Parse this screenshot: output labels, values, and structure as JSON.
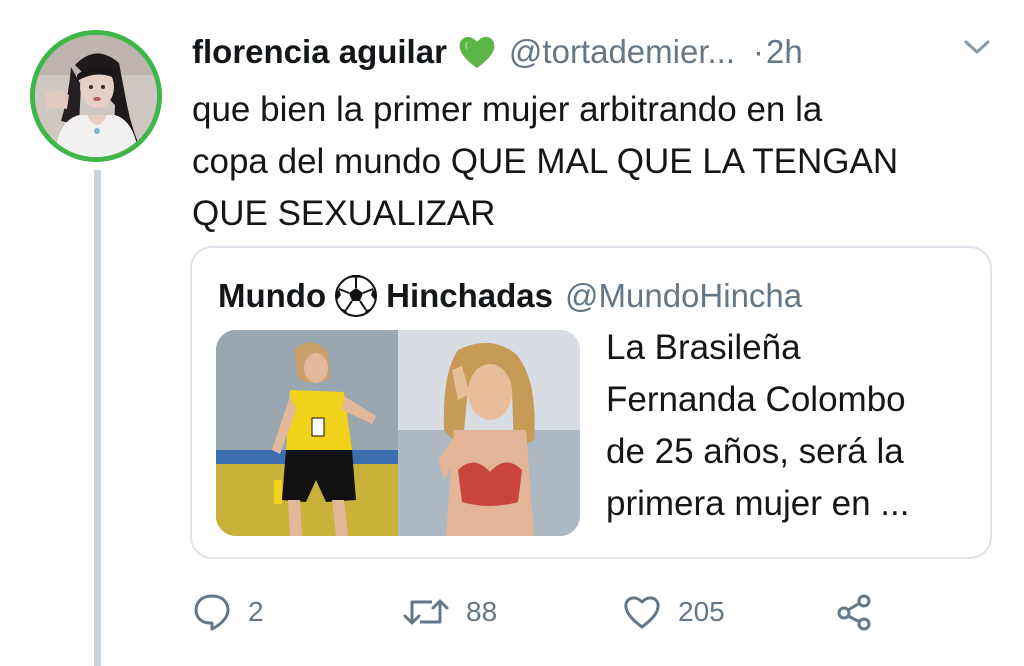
{
  "tweet": {
    "author_name": "florencia aguilar",
    "author_handle": "@tortademier...",
    "separator": "·",
    "time": "2h",
    "text_lines": [
      "que bien la primer mujer arbitrando en la",
      "copa del mundo QUE MAL QUE LA TENGAN",
      "QUE SEXUALIZAR"
    ],
    "emoji": "green-heart-icon",
    "accent_color": "#3fb64a"
  },
  "quote": {
    "name_part1": "Mundo",
    "name_part2": "Hinchadas",
    "handle": "@MundoHincha",
    "text_lines": [
      "La Brasileña",
      "Fernanda Colombo",
      "de 25 años, será la",
      "primera mujer en ..."
    ]
  },
  "actions": {
    "reply_count": "2",
    "retweet_count": "88",
    "like_count": "205"
  },
  "colors": {
    "text": "#14171a",
    "secondary": "#657786",
    "border": "#dde3e8",
    "thread_line": "#c9d3dc"
  }
}
